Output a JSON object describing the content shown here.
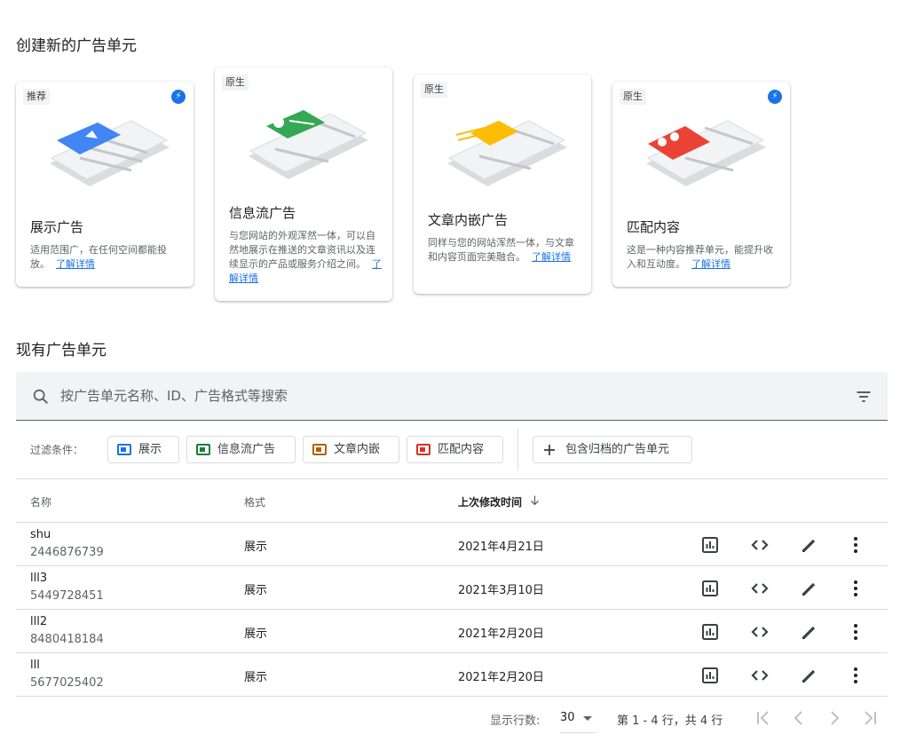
{
  "create_section": {
    "title": "创建新的广告单元",
    "cards": [
      {
        "tag": "推荐",
        "title": "展示广告",
        "desc": "适用范围广，在任何空间都能投放。",
        "link": "了解详情",
        "bolt": true,
        "accent": "#4285f4"
      },
      {
        "tag": "原生",
        "title": "信息流广告",
        "desc": "与您网站的外观浑然一体，可以自然地展示在推送的文章资讯以及连续显示的产品或服务介绍之间。",
        "link": "了解详情",
        "bolt": false,
        "accent": "#34a853"
      },
      {
        "tag": "原生",
        "title": "文章内嵌广告",
        "desc": "同样与您的网站浑然一体，与文章和内容页面完美融合。",
        "link": "了解详情",
        "bolt": false,
        "accent": "#fbbc04"
      },
      {
        "tag": "原生",
        "title": "匹配内容",
        "desc": "这是一种内容推荐单元，能提升收入和互动度。",
        "link": "了解详情",
        "bolt": true,
        "accent": "#ea4335"
      }
    ]
  },
  "existing_section": {
    "title": "现有广告单元"
  },
  "search": {
    "placeholder": "按广告单元名称、ID、广告格式等搜索"
  },
  "filters": {
    "label": "过滤条件：",
    "chips": [
      {
        "label": "展示",
        "color": "#1a73e8"
      },
      {
        "label": "信息流广告",
        "color": "#188038"
      },
      {
        "label": "文章内嵌",
        "color": "#b06000"
      },
      {
        "label": "匹配内容",
        "color": "#d93025"
      }
    ],
    "archived": "包含归档的广告单元"
  },
  "table": {
    "columns": {
      "name": "名称",
      "format": "格式",
      "modified": "上次修改时间"
    },
    "sort_icon": "arrow-down-icon",
    "rows": [
      {
        "name": "shu",
        "id": "2446876739",
        "format": "展示",
        "date": "2021年4月21日"
      },
      {
        "name": "lll3",
        "id": "5449728451",
        "format": "展示",
        "date": "2021年3月10日"
      },
      {
        "name": "lll2",
        "id": "8480418184",
        "format": "展示",
        "date": "2021年2月20日"
      },
      {
        "name": "lll",
        "id": "5677025402",
        "format": "展示",
        "date": "2021年2月20日"
      }
    ],
    "row_actions": [
      "report-icon",
      "code-icon",
      "edit-pencil-icon",
      "more-vert-icon"
    ]
  },
  "pagination": {
    "rows_label": "显示行数:",
    "rows_value": "30",
    "range": "第 1 - 4 行，共 4 行"
  }
}
